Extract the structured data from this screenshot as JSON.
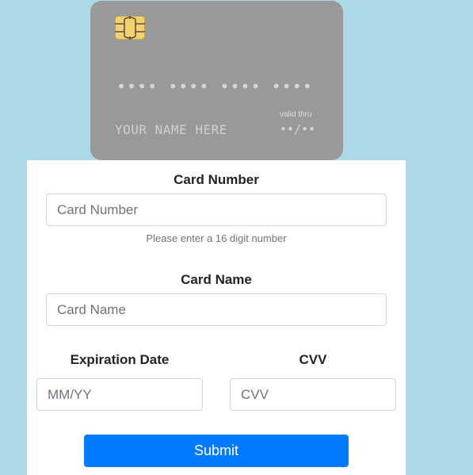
{
  "card_preview": {
    "chip_icon": "card-chip-icon",
    "number_placeholder": "•••• •••• •••• ••••",
    "name_placeholder": "YOUR NAME HERE",
    "valid_thru_label": "valid thru",
    "valid_thru_value": "••/••"
  },
  "form": {
    "card_number": {
      "label": "Card Number",
      "placeholder": "Card Number",
      "value": "",
      "help": "Please enter a 16 digit number"
    },
    "card_name": {
      "label": "Card Name",
      "placeholder": "Card Name",
      "value": ""
    },
    "expiration": {
      "label": "Expiration Date",
      "placeholder": "MM/YY",
      "value": ""
    },
    "cvv": {
      "label": "CVV",
      "placeholder": "CVV",
      "value": ""
    },
    "submit_label": "Submit"
  },
  "colors": {
    "page_background": "#add8e6",
    "card_background": "#999999",
    "chip": "#f5d06f",
    "submit_button": "#007bff"
  }
}
